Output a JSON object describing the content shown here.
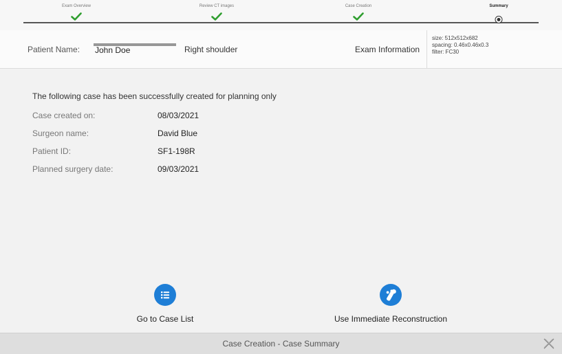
{
  "stepper": {
    "steps": [
      {
        "label": "Exam Overview",
        "status": "done"
      },
      {
        "label": "Review CT images",
        "status": "done"
      },
      {
        "label": "Case Creation",
        "status": "done"
      },
      {
        "label": "Summary",
        "status": "current"
      }
    ]
  },
  "header": {
    "patient_label": "Patient Name:",
    "patient_name": "John Doe",
    "patient_desc": "Right shoulder",
    "exam_label": "Exam Information",
    "exam_size": "size: 512x512x682",
    "exam_spacing": "spacing: 0.46x0.46x0.3",
    "exam_filter": "filter: FC30"
  },
  "content": {
    "message": "The following case has been successfully created for planning only",
    "rows": [
      {
        "key": "Case created on:",
        "value": "08/03/2021"
      },
      {
        "key": "Surgeon name:",
        "value": "David Blue"
      },
      {
        "key": "Patient ID:",
        "value": "SF1-198R"
      },
      {
        "key": "Planned surgery date:",
        "value": "09/03/2021"
      }
    ]
  },
  "actions": {
    "case_list": {
      "label": "Go to Case List",
      "icon": "list-icon"
    },
    "reconstruction": {
      "label": "Use Immediate Reconstruction",
      "icon": "bone-icon"
    }
  },
  "footer": {
    "title": "Case Creation - Case Summary"
  },
  "colors": {
    "accent": "#1e7ed6",
    "check": "#2f9e2f"
  }
}
